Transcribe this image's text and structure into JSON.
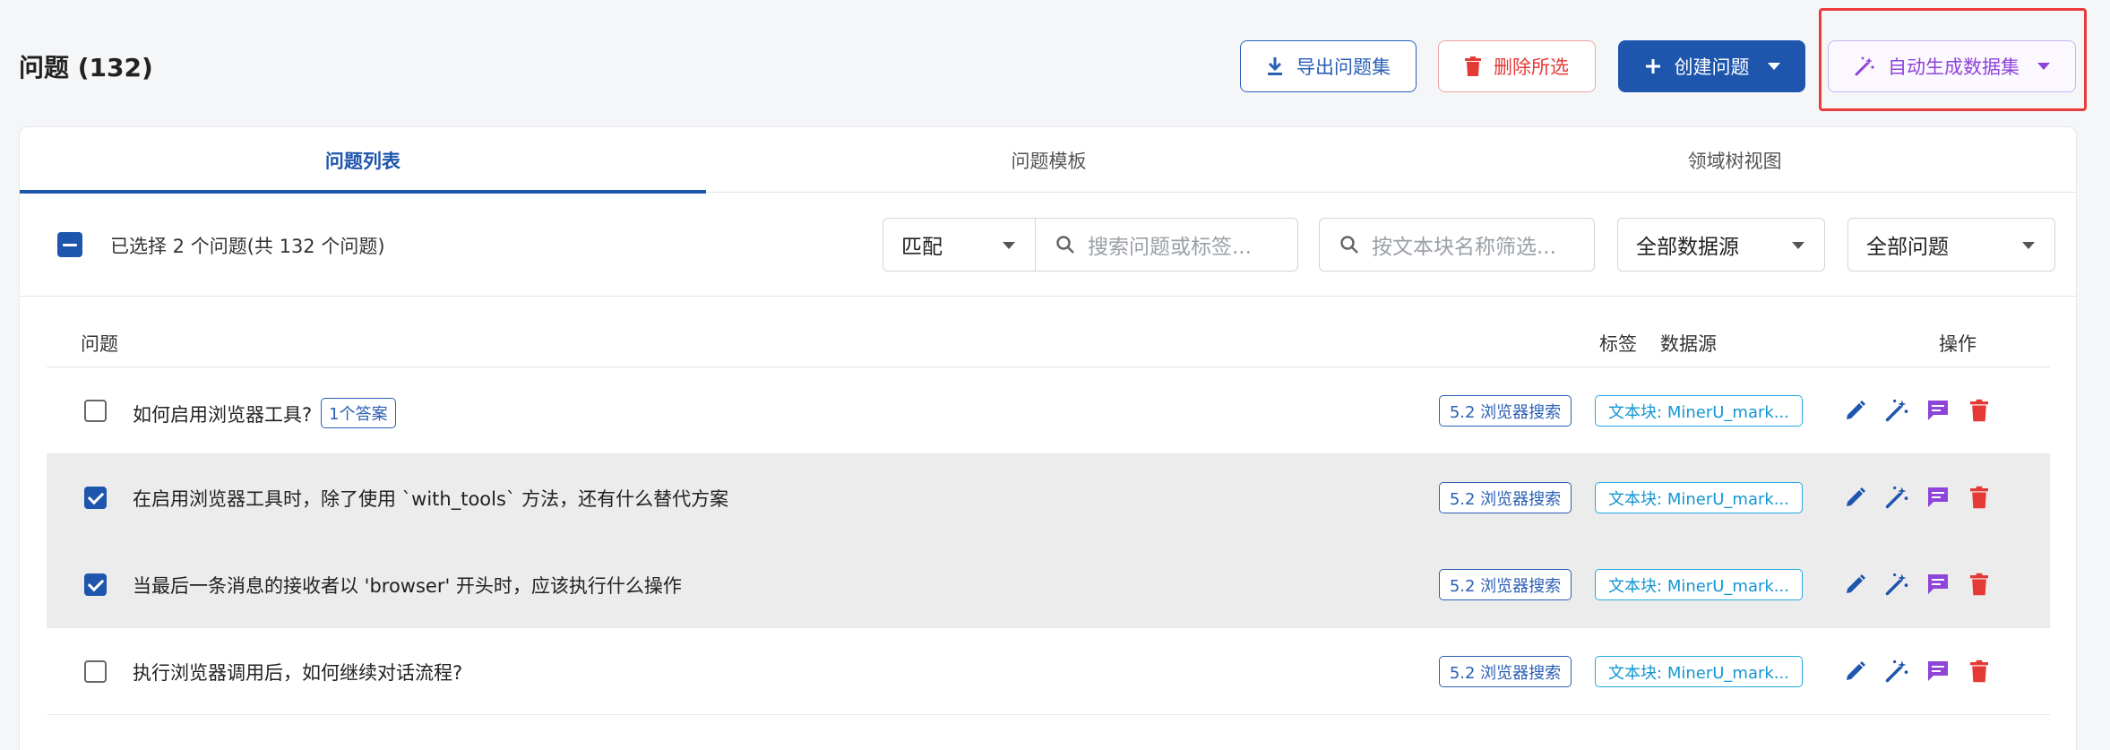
{
  "header": {
    "title": "问题 (132)",
    "export_label": "导出问题集",
    "delete_label": "删除所选",
    "create_label": "创建问题",
    "auto_label": "自动生成数据集"
  },
  "tabs": [
    {
      "label": "问题列表",
      "active": true
    },
    {
      "label": "问题模板",
      "active": false
    },
    {
      "label": "领域树视图",
      "active": false
    }
  ],
  "toolbar": {
    "selected_text": "已选择 2 个问题(共 132 个问题)",
    "match_value": "匹配",
    "search_placeholder": "搜索问题或标签...",
    "chunk_placeholder": "按文本块名称筛选...",
    "source_value": "全部数据源",
    "question_value": "全部问题"
  },
  "table": {
    "col_question": "问题",
    "col_tag": "标签",
    "col_source": "数据源",
    "col_actions": "操作",
    "rows": [
      {
        "text": "如何启用浏览器工具?",
        "answer_badge": "1个答案",
        "tag": "5.2 浏览器搜索",
        "source": "文本块: MinerU_mark...",
        "checked": false
      },
      {
        "text": "在启用浏览器工具时，除了使用 `with_tools` 方法，还有什么替代方案",
        "answer_badge": "",
        "tag": "5.2 浏览器搜索",
        "source": "文本块: MinerU_mark...",
        "checked": true
      },
      {
        "text": "当最后一条消息的接收者以 'browser' 开头时，应该执行什么操作",
        "answer_badge": "",
        "tag": "5.2 浏览器搜索",
        "source": "文本块: MinerU_mark...",
        "checked": true
      },
      {
        "text": "执行浏览器调用后，如何继续对话流程?",
        "answer_badge": "",
        "tag": "5.2 浏览器搜索",
        "source": "文本块: MinerU_mark...",
        "checked": false
      }
    ]
  },
  "colors": {
    "primary": "#1f56ad",
    "danger": "#e53935",
    "purple": "#8e44d8",
    "source": "#1496d2"
  }
}
